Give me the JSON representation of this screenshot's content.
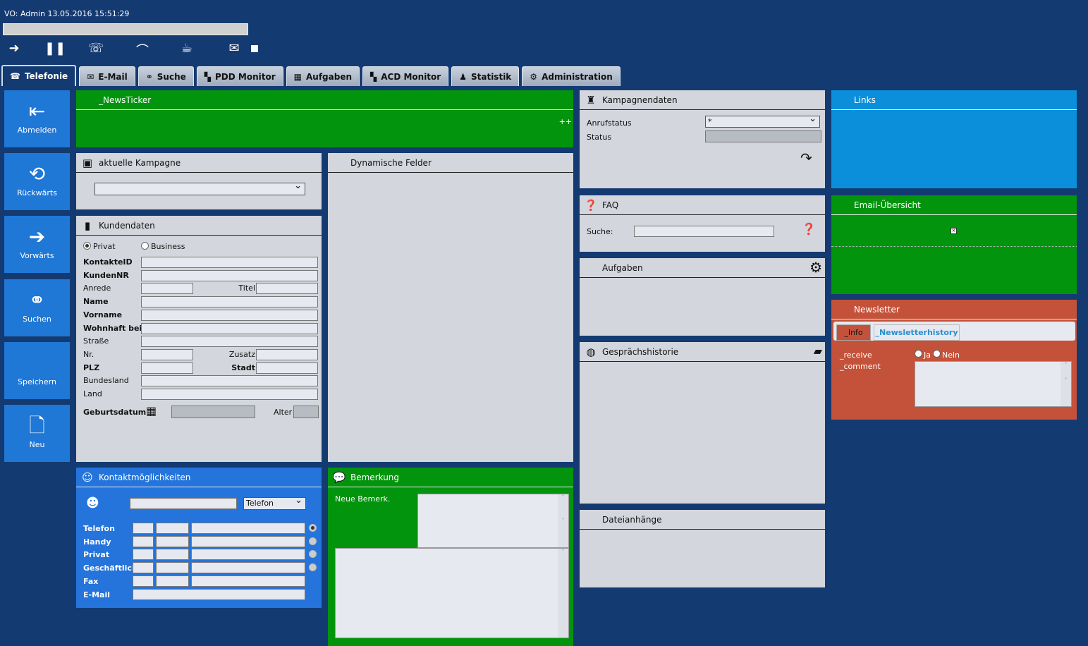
{
  "header": {
    "session": "VO: Admin 13.05.2016 15:51:29"
  },
  "toolbar": [
    {
      "icon": "login-agent-icon",
      "g": "➜"
    },
    {
      "icon": "pause-icon",
      "g": "❚❚"
    },
    {
      "icon": "phone-icon",
      "g": "☏"
    },
    {
      "icon": "hangup-icon",
      "g": "⌒"
    },
    {
      "icon": "coffee-break-icon",
      "g": "☕"
    },
    {
      "icon": "mail-break-icon",
      "g": "✉"
    }
  ],
  "tabs": [
    {
      "label": "Telefonie",
      "icon": "phone-tab-icon",
      "g": "☎"
    },
    {
      "label": "E-Mail",
      "icon": "mail-icon",
      "g": "✉"
    },
    {
      "label": "Suche",
      "icon": "binoculars-icon",
      "g": "⚭"
    },
    {
      "label": "PDD Monitor",
      "icon": "monitor-icon",
      "g": "▚"
    },
    {
      "label": "Aufgaben",
      "icon": "calendar-icon",
      "g": "▦"
    },
    {
      "label": "ACD Monitor",
      "icon": "monitor-icon",
      "g": "▚"
    },
    {
      "label": "Statistik",
      "icon": "person-icon",
      "g": "♟"
    },
    {
      "label": "Administration",
      "icon": "admin-icon",
      "g": "⚙"
    }
  ],
  "sidebar": [
    {
      "label": "Abmelden",
      "icon": "logout-door-icon",
      "g": "⇤"
    },
    {
      "label": "Rückwärts",
      "icon": "back-arrow-icon",
      "g": "⟲"
    },
    {
      "label": "Vorwärts",
      "icon": "forward-arrow-icon",
      "g": "➔"
    },
    {
      "label": "Suchen",
      "icon": "binoculars-icon",
      "g": "⚭"
    },
    {
      "label": "Speichern",
      "icon": "save-icon",
      "g": ""
    },
    {
      "label": "Neu",
      "icon": "new-document-icon",
      "g": "🗋"
    }
  ],
  "newsticker": {
    "title": "_NewsTicker",
    "more": "++"
  },
  "kampagne": {
    "title": "aktuelle Kampagne",
    "value": ""
  },
  "dynamisch": {
    "title": "Dynamische Felder"
  },
  "kunden": {
    "title": "Kundendaten",
    "privat": "Privat",
    "business": "Business",
    "rows": [
      {
        "l": "KontakteID",
        "b": true
      },
      {
        "l": "KundenNR",
        "b": true
      },
      {
        "l": "Anrede",
        "r": "Titel"
      },
      {
        "l": "Name",
        "b": true
      },
      {
        "l": "Vorname",
        "b": true
      },
      {
        "l": "Wohnhaft bei",
        "b": true
      },
      {
        "l": "Straße"
      },
      {
        "l": "Nr.",
        "r": "Zusatz"
      },
      {
        "l": "PLZ",
        "b": true,
        "r": "Stadt",
        "rb": true
      },
      {
        "l": "Bundesland"
      },
      {
        "l": "Land"
      }
    ],
    "geburtsdatum": "Geburtsdatum",
    "alter": "Alter"
  },
  "kontakt": {
    "title": "Kontaktmöglichkeiten",
    "type": "Telefon",
    "rows": [
      "Telefon",
      "Handy",
      "Privat",
      "Geschäftlich",
      "Fax",
      "E-Mail"
    ]
  },
  "bemerkung": {
    "title": "Bemerkung",
    "neue": "Neue Bemerk."
  },
  "kampagnendaten": {
    "title": "Kampagnendaten",
    "anrufstatus": "Anrufstatus",
    "anrufstatus_value": "*",
    "status": "Status"
  },
  "faq": {
    "title": "FAQ",
    "suche": "Suche:"
  },
  "aufgaben": {
    "title": "Aufgaben"
  },
  "historie": {
    "title": "Gesprächshistorie"
  },
  "dateien": {
    "title": "Dateianhänge"
  },
  "links": {
    "title": "Links"
  },
  "email": {
    "title": "Email-Übersicht"
  },
  "newsletter": {
    "title": "Newsletter",
    "tab_info": "_Info",
    "tab_history": "_Newsletterhistory",
    "receive": "_receive",
    "ja": "Ja",
    "nein": "Nein",
    "comment": "_comment"
  },
  "colors": {
    "background": "#143a72",
    "tile": "#1f77d6",
    "green": "#03940d",
    "panel": "#d3d6dc",
    "links": "#0b8fda",
    "newsletter": "#c4523a"
  }
}
